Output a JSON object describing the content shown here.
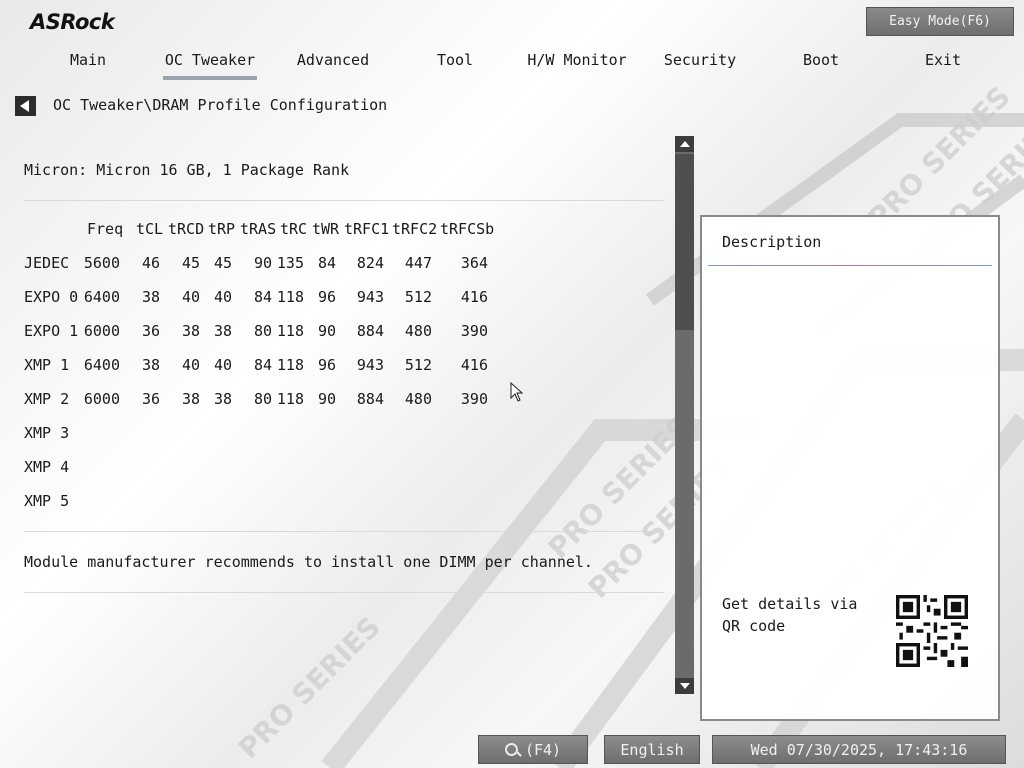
{
  "brand": "ASRock",
  "easy_mode_label": "Easy Mode(F6)",
  "nav": {
    "tabs": [
      {
        "label": "Main"
      },
      {
        "label": "OC Tweaker"
      },
      {
        "label": "Advanced"
      },
      {
        "label": "Tool"
      },
      {
        "label": "H/W Monitor"
      },
      {
        "label": "Security"
      },
      {
        "label": "Boot"
      },
      {
        "label": "Exit"
      }
    ],
    "active": "OC Tweaker"
  },
  "breadcrumb": "OC Tweaker\\DRAM Profile Configuration",
  "module": "Micron: Micron 16 GB, 1 Package Rank",
  "table": {
    "headers": [
      "Freq",
      "tCL",
      "tRCD",
      "tRP",
      "tRAS",
      "tRC",
      "tWR",
      "tRFC1",
      "tRFC2",
      "tRFCSb"
    ],
    "rows": [
      {
        "label": "JEDEC",
        "values": [
          "5600",
          "46",
          "45",
          "45",
          "90",
          "135",
          "84",
          "824",
          "447",
          "364"
        ]
      },
      {
        "label": "EXPO 0",
        "values": [
          "6400",
          "38",
          "40",
          "40",
          "84",
          "118",
          "96",
          "943",
          "512",
          "416"
        ]
      },
      {
        "label": "EXPO 1",
        "values": [
          "6000",
          "36",
          "38",
          "38",
          "80",
          "118",
          "90",
          "884",
          "480",
          "390"
        ]
      },
      {
        "label": "XMP 1",
        "values": [
          "6400",
          "38",
          "40",
          "40",
          "84",
          "118",
          "96",
          "943",
          "512",
          "416"
        ]
      },
      {
        "label": "XMP 2",
        "values": [
          "6000",
          "36",
          "38",
          "38",
          "80",
          "118",
          "90",
          "884",
          "480",
          "390"
        ]
      },
      {
        "label": "XMP 3",
        "values": []
      },
      {
        "label": "XMP 4",
        "values": []
      },
      {
        "label": "XMP 5",
        "values": []
      }
    ]
  },
  "note": "Module manufacturer recommends to install one DIMM per channel.",
  "description": {
    "title": "Description",
    "qr_text": "Get details via QR code"
  },
  "bottom": {
    "search_label": "(F4)",
    "language": "English",
    "datetime": "Wed 07/30/2025, 17:43:16"
  }
}
